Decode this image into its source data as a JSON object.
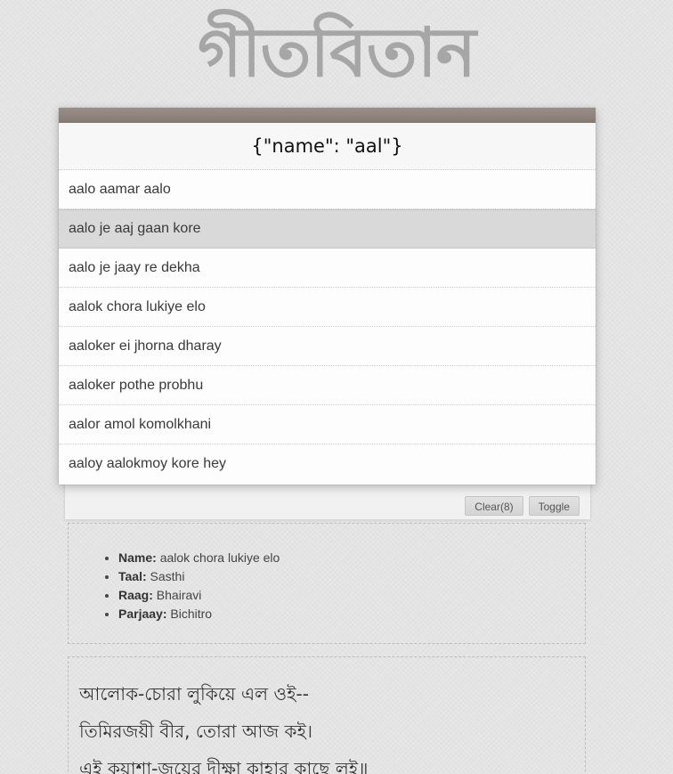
{
  "site": {
    "title": "গীতবিতান"
  },
  "popup": {
    "query_display": "{\"name\": \"aal\"}",
    "results": [
      "aalo aamar aalo",
      "aalo je aaj gaan kore",
      "aalo je jaay re dekha",
      "aalok chora lukiye elo",
      "aaloker ei jhorna dharay",
      "aaloker pothe probhu",
      "aalor amol komolkhani",
      "aaloy aalokmoy kore hey"
    ],
    "selected_index": 1
  },
  "controls": {
    "clear_label": "Clear(8)",
    "toggle_label": "Toggle"
  },
  "details": {
    "name_label": "Name:",
    "name_value": "aalok chora lukiye elo",
    "taal_label": "Taal:",
    "taal_value": "Sasthi",
    "raag_label": "Raag:",
    "raag_value": "Bhairavi",
    "parjaay_label": "Parjaay:",
    "parjaay_value": "Bichitro"
  },
  "lyrics": {
    "lines": [
      "আলোক-চোরা লুকিয়ে এল ওই--",
      "তিমিরজয়ী বীর, তোরা আজ কই।",
      "এই কয়াশা-জয়ের দীক্ষা কাহার কাছে লই॥"
    ]
  },
  "colors": {
    "popup_bar": "#8c817a",
    "selected_row": "#d9d9d9",
    "title": "#a6a6a6"
  }
}
